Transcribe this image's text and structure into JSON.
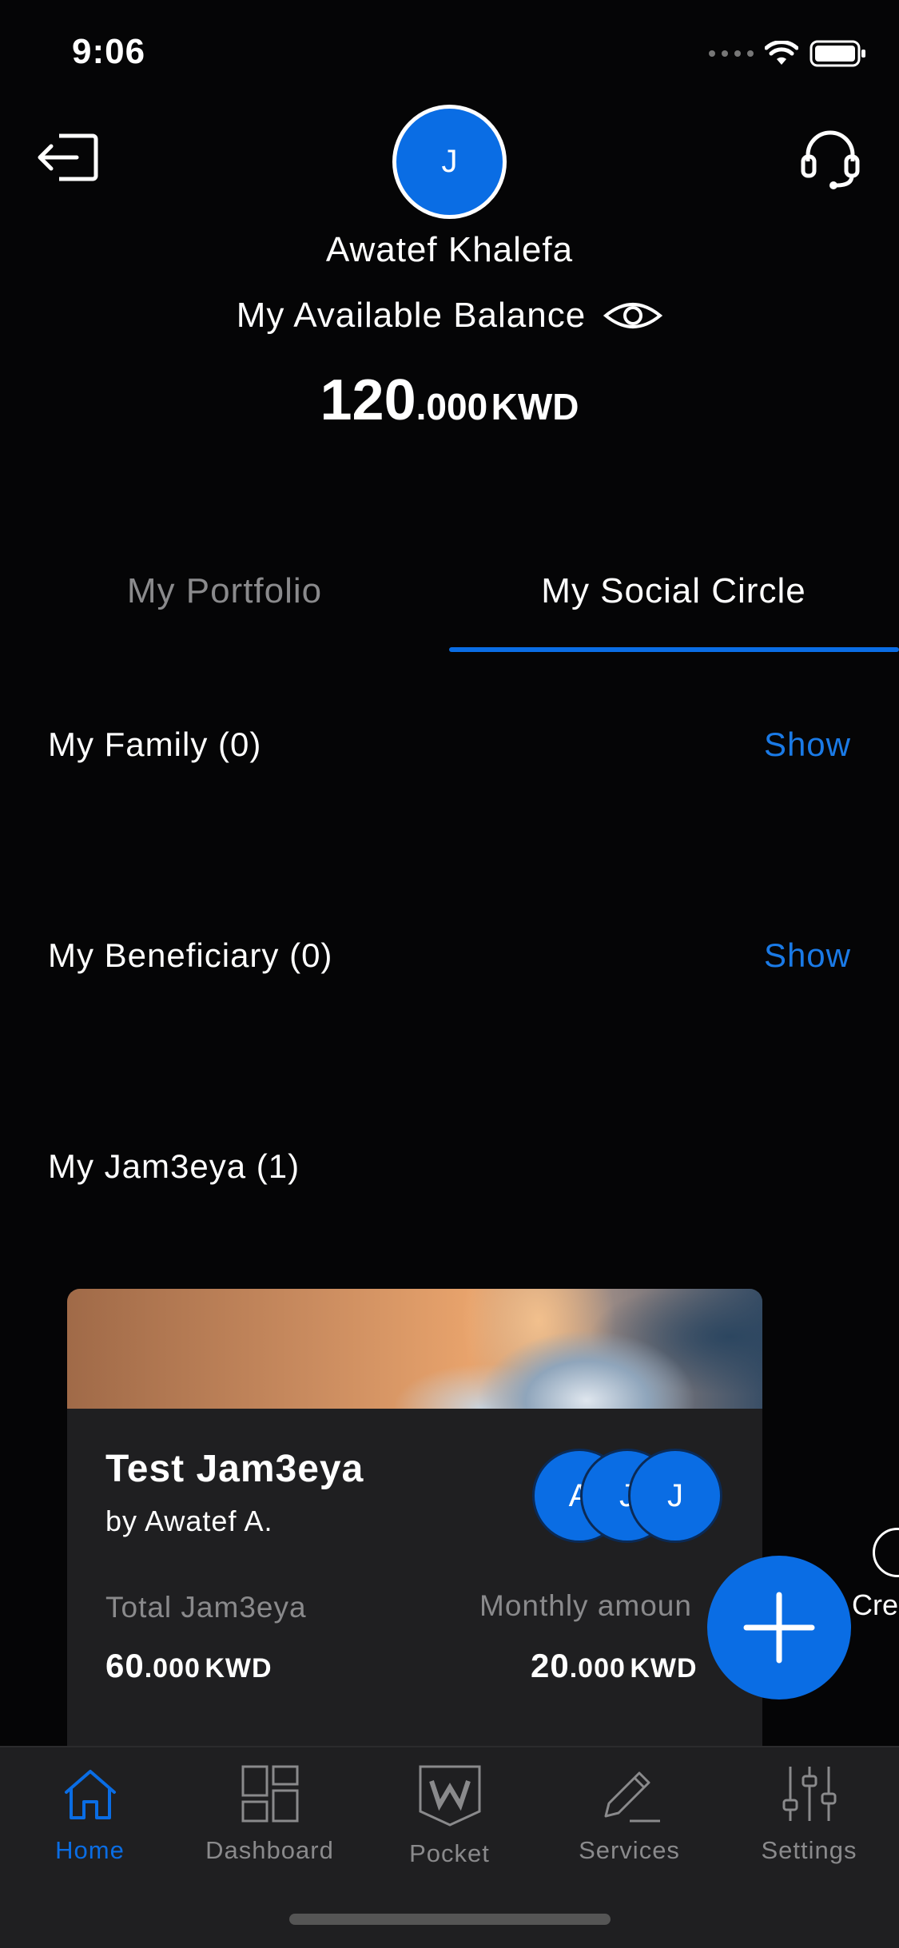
{
  "status_bar": {
    "time": "9:06"
  },
  "header": {
    "avatar_initial": "J",
    "user_name": "Awatef Khalefa",
    "balance_label": "My Available Balance",
    "balance_integer": "120",
    "balance_decimal": ".000",
    "balance_currency": "KWD"
  },
  "tabs": [
    {
      "label": "My Portfolio",
      "active": false
    },
    {
      "label": "My Social Circle",
      "active": true
    }
  ],
  "sections": {
    "family": {
      "label": "My Family (0)",
      "action": "Show"
    },
    "beneficiary": {
      "label": "My Beneficiary (0)",
      "action": "Show"
    },
    "jam3eya": {
      "label": "My Jam3eya (1)"
    }
  },
  "jam3eya_card": {
    "title": "Test Jam3eya",
    "by": "by Awatef A.",
    "members": [
      "A",
      "J",
      "J"
    ],
    "total_label": "Total Jam3eya",
    "total_int": "60",
    "total_dec": ".000",
    "total_currency": "KWD",
    "monthly_label": "Monthly amoun",
    "monthly_int": "20",
    "monthly_dec": ".000",
    "monthly_currency": "KWD"
  },
  "side_action": {
    "label": "Cre"
  },
  "bottom_nav": [
    {
      "label": "Home",
      "active": true,
      "icon": "home-icon"
    },
    {
      "label": "Dashboard",
      "active": false,
      "icon": "dashboard-icon"
    },
    {
      "label": "Pocket",
      "active": false,
      "icon": "pocket-icon"
    },
    {
      "label": "Services",
      "active": false,
      "icon": "pencil-icon"
    },
    {
      "label": "Settings",
      "active": false,
      "icon": "sliders-icon"
    }
  ],
  "colors": {
    "accent": "#0a6de4",
    "link": "#1a7ae6",
    "background": "#050506",
    "card": "#1f1f21"
  }
}
